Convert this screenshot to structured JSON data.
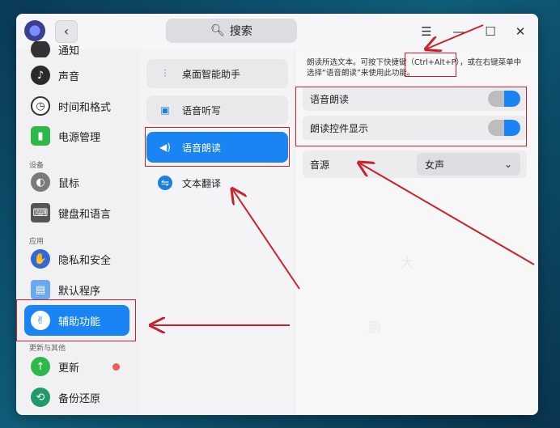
{
  "search": {
    "label": "搜索"
  },
  "sidebar": {
    "items": [
      {
        "label": "通知",
        "partial": true
      },
      {
        "label": "声音"
      },
      {
        "label": "时间和格式"
      },
      {
        "label": "电源管理"
      },
      {
        "label": "鼠标"
      },
      {
        "label": "键盘和语言"
      },
      {
        "label": "隐私和安全"
      },
      {
        "label": "默认程序"
      },
      {
        "label": "辅助功能",
        "active": true
      },
      {
        "label": "更新"
      },
      {
        "label": "备份还原"
      }
    ],
    "groups": [
      "设备",
      "应用",
      "更新与其他"
    ]
  },
  "mid": {
    "items": [
      {
        "label": "桌面智能助手"
      },
      {
        "label": "语音听写"
      },
      {
        "label": "语音朗读",
        "active": true
      },
      {
        "label": "文本翻译"
      }
    ]
  },
  "right": {
    "description": "朗读所选文本。可按下快捷键（Ctrl+Alt+P），或在右键菜单中选择“语音朗读”来使用此功能。",
    "toggles": [
      {
        "label": "语音朗读",
        "on": true
      },
      {
        "label": "朗读控件显示",
        "on": true
      }
    ],
    "voice": {
      "label": "音源",
      "value": "女声"
    }
  },
  "colors": {
    "accent": "#1a84f5",
    "annotation": "#c8232c"
  },
  "icons": {
    "logo": "app-logo",
    "back": "chevron-left-icon",
    "search": "search-icon",
    "menu": "menu-icon",
    "minimize": "minimize-icon",
    "maximize": "maximize-icon",
    "close": "close-icon"
  }
}
